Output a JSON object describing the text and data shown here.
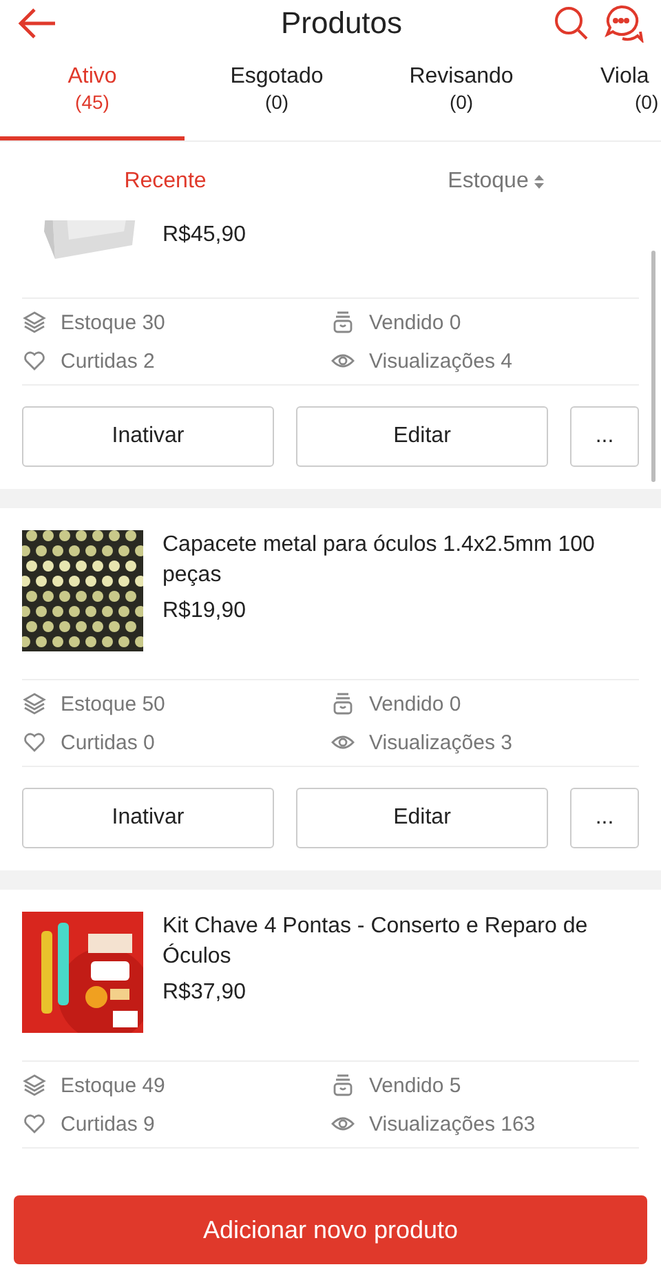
{
  "header": {
    "title": "Produtos"
  },
  "tabs": [
    {
      "label": "Ativo",
      "count": "(45)",
      "selected": true
    },
    {
      "label": "Esgotado",
      "count": "(0)",
      "selected": false
    },
    {
      "label": "Revisando",
      "count": "(0)",
      "selected": false
    },
    {
      "label": "Viola",
      "count": "(0)",
      "selected": false
    }
  ],
  "sort": [
    {
      "label": "Recente",
      "selected": true,
      "kind": "plain"
    },
    {
      "label": "Estoque",
      "selected": false,
      "kind": "toggle"
    }
  ],
  "products": [
    {
      "price": "R$45,90",
      "image": {
        "kind": "picture"
      },
      "stock": "Estoque 30",
      "sold": "Vendido 0",
      "likes": "Curtidas 2",
      "views": "Visualizações 4",
      "actions": [
        "Inativar",
        "Editar",
        "..."
      ]
    },
    {
      "title": "Capacete metal para óculos 1.4x2.5mm 100 peças",
      "price": "R$19,90",
      "image": {
        "kind": "picture"
      },
      "stock": "Estoque 50",
      "sold": "Vendido 0",
      "likes": "Curtidas 0",
      "views": "Visualizações 3",
      "actions": [
        "Inativar",
        "Editar",
        "..."
      ]
    },
    {
      "title": "Kit Chave 4 Pontas - Conserto e Reparo de Óculos",
      "price": "R$37,90",
      "image": {
        "kind": "picture"
      },
      "stock": "Estoque 49",
      "sold": "Vendido 5",
      "likes": "Curtidas 9",
      "views": "Visualizações 163"
    }
  ],
  "add_button": "Adicionar novo produto"
}
